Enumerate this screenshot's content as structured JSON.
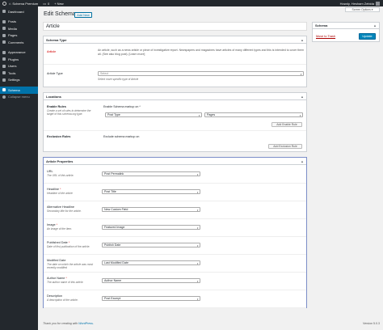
{
  "adminbar": {
    "site_name": "Schema Premium",
    "comments_count": "0",
    "new_label": "+ New",
    "greeting": "Howdy, Hesham Zebida"
  },
  "sidebar": {
    "items": [
      {
        "label": "Dashboard",
        "icon": "dashboard-icon"
      },
      {
        "label": "Posts",
        "icon": "pin-icon"
      },
      {
        "label": "Media",
        "icon": "media-icon"
      },
      {
        "label": "Pages",
        "icon": "page-icon"
      },
      {
        "label": "Comments",
        "icon": "comment-icon"
      },
      {
        "label": "Appearance",
        "icon": "brush-icon"
      },
      {
        "label": "Plugins",
        "icon": "plugin-icon"
      },
      {
        "label": "Users",
        "icon": "users-icon"
      },
      {
        "label": "Tools",
        "icon": "wrench-icon"
      },
      {
        "label": "Settings",
        "icon": "settings-icon"
      },
      {
        "label": "Schema",
        "icon": "schema-icon"
      },
      {
        "label": "Collapse menu",
        "icon": "collapse-icon"
      }
    ]
  },
  "header": {
    "screen_options": "Screen Options ▾",
    "page_title": "Edit Schema",
    "add_new": "Add New",
    "title_value": "Article"
  },
  "schema_type": {
    "heading": "Schema Type",
    "type_label": "Article",
    "type_description": "An article, such as a news article or piece of investigative report. Newspapers and magazines have articles of many different types and this is intended to cover them all. (See also blog post). [Learn more]",
    "article_type_label": "Article Type",
    "article_type_value": "Select",
    "article_type_help": "Select more specific type of Article"
  },
  "locations": {
    "heading": "Locations",
    "enable_rules_label": "Enable Rules",
    "enable_rules_desc": "Create a set of rules to determine the target of this schema.org type.",
    "enable_on_label": "Enable Schema markup on *",
    "post_type_value": "Post Type",
    "pages_value": "Pages",
    "add_enable_rule": "Add Enable Rule",
    "exclusion_label": "Exclusion Rules",
    "exclude_text": "Exclude schema markup on",
    "add_exclusion_rule": "Add Exclusion Rule"
  },
  "article_properties": {
    "heading": "Article Properties",
    "rows": [
      {
        "label": "URL",
        "required": false,
        "desc": "The URL of this article.",
        "value": "Post Permalink"
      },
      {
        "label": "Headline",
        "required": true,
        "desc": "Headline of the article",
        "value": "Post Title"
      },
      {
        "label": "Alternative Headline",
        "required": false,
        "desc": "Secondary title for the article.",
        "value": "New Custom Field"
      },
      {
        "label": "Image",
        "required": true,
        "desc": "An image of the item.",
        "value": "Featured Image"
      },
      {
        "label": "Published Date",
        "required": true,
        "desc": "Date of first publication of the article.",
        "value": "Publish Date"
      },
      {
        "label": "Modified Date",
        "required": false,
        "desc": "The date on which the article was most recently modified",
        "value": "Last Modified Date"
      },
      {
        "label": "Author Name",
        "required": true,
        "desc": "The author name of this article.",
        "value": "Author Name"
      },
      {
        "label": "Description",
        "required": false,
        "desc": "A description of the article.",
        "value": "Post Excerpt"
      }
    ]
  },
  "publish_box": {
    "heading": "Schema",
    "trash": "Move to Trash",
    "update": "Update"
  },
  "footer": {
    "thanks": "Thank you for creating with",
    "wordpress": "WordPress.",
    "version": "Version 5.0.3"
  },
  "colors": {
    "admin_dark": "#23282d",
    "accent": "#0073aa",
    "highlight_border": "#7b8ec8",
    "required": "#dc3232"
  }
}
